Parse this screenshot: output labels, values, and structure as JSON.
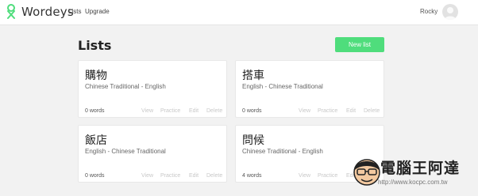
{
  "navbar": {
    "brand": "Wordeys",
    "links": [
      "Lists",
      "Upgrade"
    ],
    "username": "Rocky",
    "accent_color": "#4fdd7c"
  },
  "main": {
    "title": "Lists",
    "new_list_label": "New list",
    "actions": [
      "View",
      "Practice",
      "Edit",
      "Delete"
    ],
    "cards": [
      {
        "title": "購物",
        "subtitle": "Chinese Traditional - English",
        "count": "0 words"
      },
      {
        "title": "搭車",
        "subtitle": "English - Chinese Traditional",
        "count": "0 words"
      },
      {
        "title": "飯店",
        "subtitle": "English - Chinese Traditional",
        "count": "0 words"
      },
      {
        "title": "問候",
        "subtitle": "Chinese Traditional - English",
        "count": "4 words"
      }
    ]
  },
  "watermark": {
    "text": "電腦王阿達",
    "url": "http://www.kocpc.com.tw"
  }
}
